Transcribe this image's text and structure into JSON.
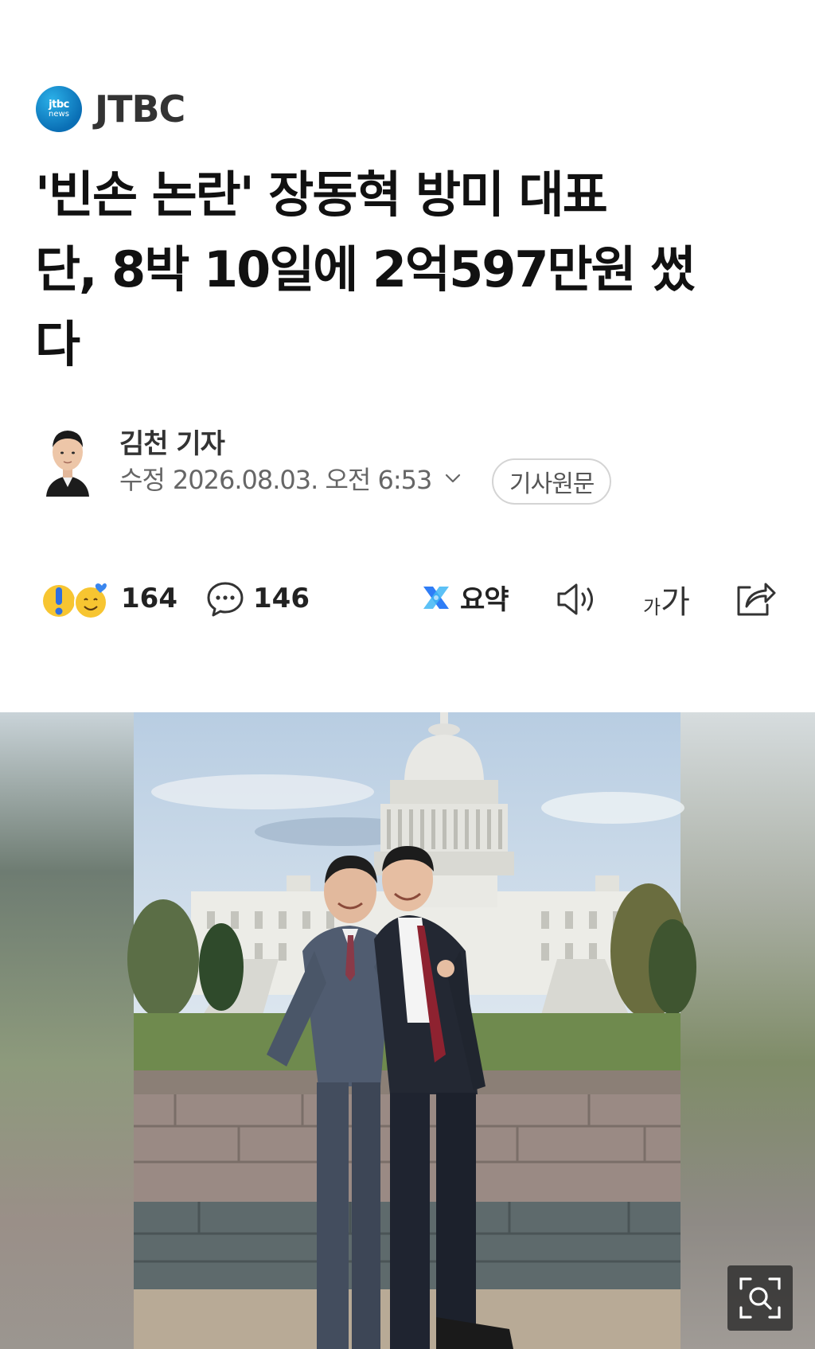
{
  "press": {
    "name": "JTBC",
    "logo_line1": "jtbc",
    "logo_line2": "news"
  },
  "article": {
    "title_line1": "'빈손 논란' 장동혁 방미 대표",
    "title_line2": "단, 8박 10일에 2억597만원 썼",
    "title_line3": "다"
  },
  "byline": {
    "reporter": "김천 기자",
    "status": "수정",
    "datetime": "2026.08.03. 오전 6:53",
    "source_button": "기사원문"
  },
  "actions": {
    "reaction_count": "164",
    "comment_count": "146",
    "summary_label": "요약",
    "font_small": "가",
    "font_large": "가"
  },
  "icons": {
    "press_logo": "jtbc-news-logo",
    "reactions": [
      "exclamation-face-icon",
      "smile-heart-face-icon"
    ],
    "comment": "speech-bubble-icon",
    "summary": "ai-summary-icon",
    "audio": "speaker-icon",
    "share": "share-icon",
    "zoom": "zoom-icon",
    "chevron": "chevron-down-icon"
  },
  "colors": {
    "brand_blue": "#0a6fb5",
    "summary_blue": "#2f7df6",
    "reaction_yellow": "#f7c531"
  }
}
